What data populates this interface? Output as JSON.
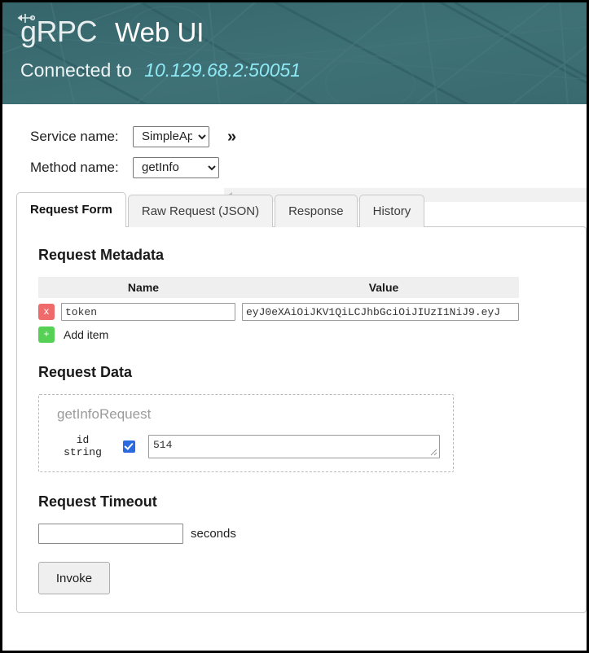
{
  "header": {
    "logo_text": "gRPC",
    "logo_icon": "grpc-node-arrow-icon",
    "app_title": "Web UI",
    "connected_label": "Connected to",
    "connected_address": "10.129.68.2:50051",
    "bg_color": "#3c6d73",
    "address_color": "#8fe9f5"
  },
  "selectors": {
    "service_label": "Service name:",
    "service_value": "SimpleApp",
    "service_options": [
      "SimpleApp"
    ],
    "method_label": "Method name:",
    "method_value": "getInfo",
    "method_options": [
      "getInfo"
    ],
    "expand_button": "»"
  },
  "tabs": [
    {
      "label": "Request Form",
      "active": true
    },
    {
      "label": "Raw Request (JSON)",
      "active": false
    },
    {
      "label": "Response",
      "active": false
    },
    {
      "label": "History",
      "active": false
    }
  ],
  "metadata": {
    "section_title": "Request Metadata",
    "columns": [
      "Name",
      "Value"
    ],
    "rows": [
      {
        "remove_label": "x",
        "name": "token",
        "value": "eyJ0eXAiOiJKV1QiLCJhbGciOiJIUzI1NiJ9.eyJ"
      }
    ],
    "add_icon_label": "+",
    "add_label": "Add item"
  },
  "request_data": {
    "section_title": "Request Data",
    "message_name": "getInfoRequest",
    "fields": [
      {
        "name": "id",
        "type": "string",
        "enabled": true,
        "value": "514"
      }
    ]
  },
  "timeout": {
    "section_title": "Request Timeout",
    "value": "",
    "placeholder": "",
    "unit_label": "seconds"
  },
  "actions": {
    "invoke_label": "Invoke"
  }
}
